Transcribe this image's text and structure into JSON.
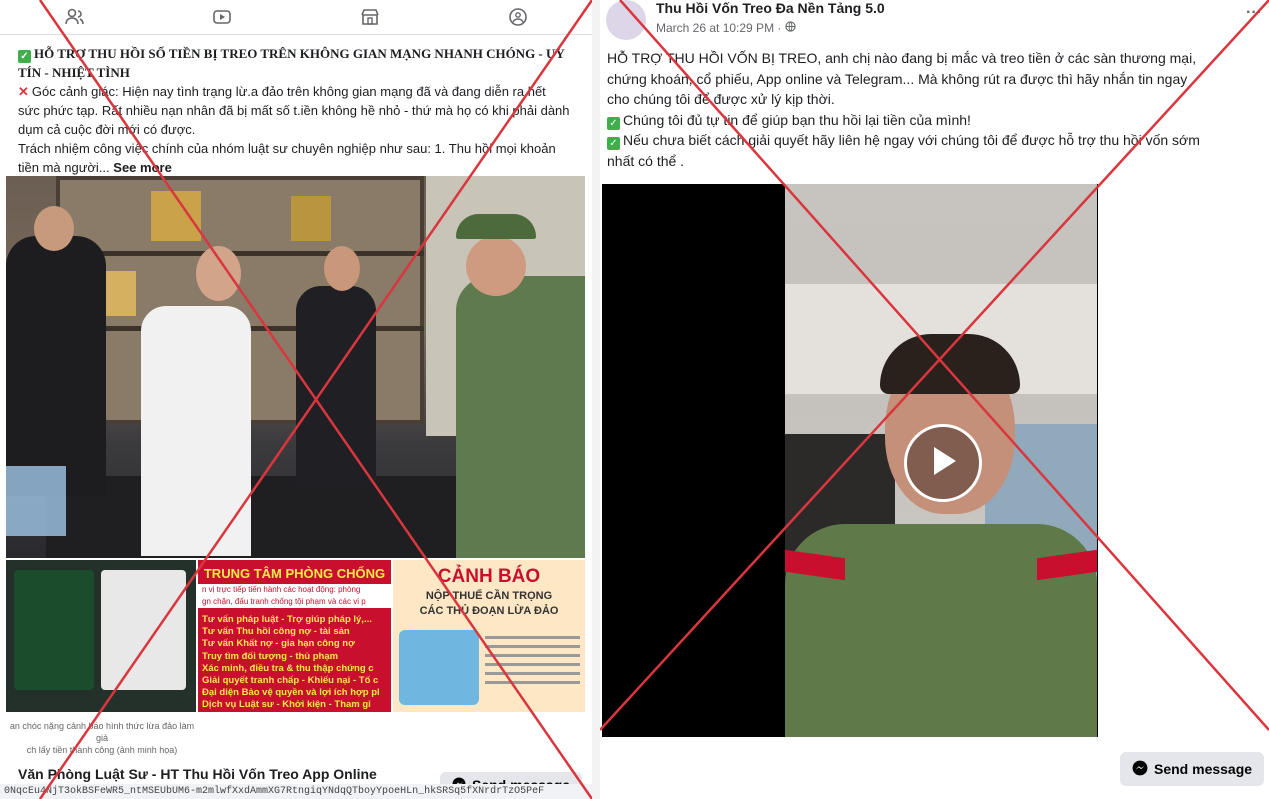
{
  "left_post": {
    "line0": "",
    "title_line1": "HỖ TRỢ THU HỒI SỐ TIỀN BỊ TREO TRÊN KHÔNG GIAN MẠNG NHANH CHÓNG - UY",
    "title_line2": "TÍN - NHIỆT TÌNH",
    "para1_line1": "Góc cảnh giác: Hiện nay tình trạng lừ.a đảo trên không gian mạng đã và đang diễn ra hết",
    "para1_line2": "sức phức tạp. Rất nhiều nạn nhân đã bị mất số t.iền không hề nhỏ - thứ mà họ có khi phải dành",
    "para1_line3": "dụm cả cuộc đời mới có được.",
    "para2_line1": "Trách nhiệm công việc chính của nhóm luật sư chuyên nghiệp như sau: 1. Thu hồi mọi khoản",
    "para2_line2": "tiền mà người...",
    "see_more": "See more",
    "banner_left_title": "TRUNG TÂM PHÒNG CHỐNG",
    "banner_left_sub1": "n vị trực tiếp tiến hành các hoạt động: phòng",
    "banner_left_sub2": "gn chặn, đấu tranh chống tội phạm và các vi p",
    "banner_services": [
      "Tư vấn pháp luật - Trợ giúp pháp lý,...",
      "Tư vấn Thu hồi công nợ - tài sản",
      "Tư vấn Khất nợ - gia hạn công nợ",
      "Truy tìm đối tượng - thủ phạm",
      "Xác minh, điều tra & thu thập chứng c",
      "Giải quyết tranh chấp - Khiếu nại - Tố c",
      "Đại diện Bảo vệ quyền và lợi ích hợp pl",
      "Dịch vụ Luật sư - Khởi kiện - Tham gi"
    ],
    "banner_right_title": "CẢNH BÁO",
    "banner_right_sub1": "NỘP THUẾ CẦN TRỌNG",
    "banner_right_sub2": "CÁC THỦ ĐOẠN LỪA ĐẢO",
    "caption_line1": "an chóc nặng cảnh báo  hình thức lừa đảo làm giả",
    "caption_line2": "ch lấy tiền thành công (ảnh minh họa)",
    "page_name": "Văn Phòng Luật Sư - HT Thu Hồi Vốn Treo App Online",
    "send_message": "Send message",
    "url": "0NqcEu4NjT3okBSFeWR5_ntMSEUbUM6-m2mlwfXxdAmmXG7RtngiqYNdqQTboyYpoeHLn_hkSRSq5fXNrdrTzO5PeF"
  },
  "right_post": {
    "page_name": "Thu Hồi Vốn Treo Đa Nền Tảng 5.0",
    "timestamp": "March 26 at 10:29 PM ·",
    "more": "···",
    "text_line1": "HỖ TRỢ THU HỒI VỐN BỊ TREO,  anh chị nào đang bị mắc và treo tiền  ở các sàn thương mại,",
    "text_line2": "chứng khoán, cổ phiếu, App online và  Telegram... Mà không rút ra được thì hãy nhắn tin ngay",
    "text_line3": "cho chúng tôi để được xử lý kịp thời.",
    "text_line4": "Chúng tôi đủ tự tin để giúp bạn thu hồi  lại tiền của mình!",
    "text_line5": "Nếu chưa biết cách giải quyết hãy liên hệ ngay với chúng tôi để được hỗ trợ thu hồi vốn sớm",
    "text_line6": "nhất có thể .",
    "send_message": "Send message"
  },
  "icons": [
    "friends-icon",
    "video-icon",
    "marketplace-icon",
    "groups-icon",
    "play-icon",
    "messenger-icon",
    "globe-icon"
  ],
  "colors": {
    "cross": "#d9363e",
    "check": "#3eaf4b",
    "banner_red": "#c8102e",
    "banner_yellow": "#ffe94d"
  }
}
